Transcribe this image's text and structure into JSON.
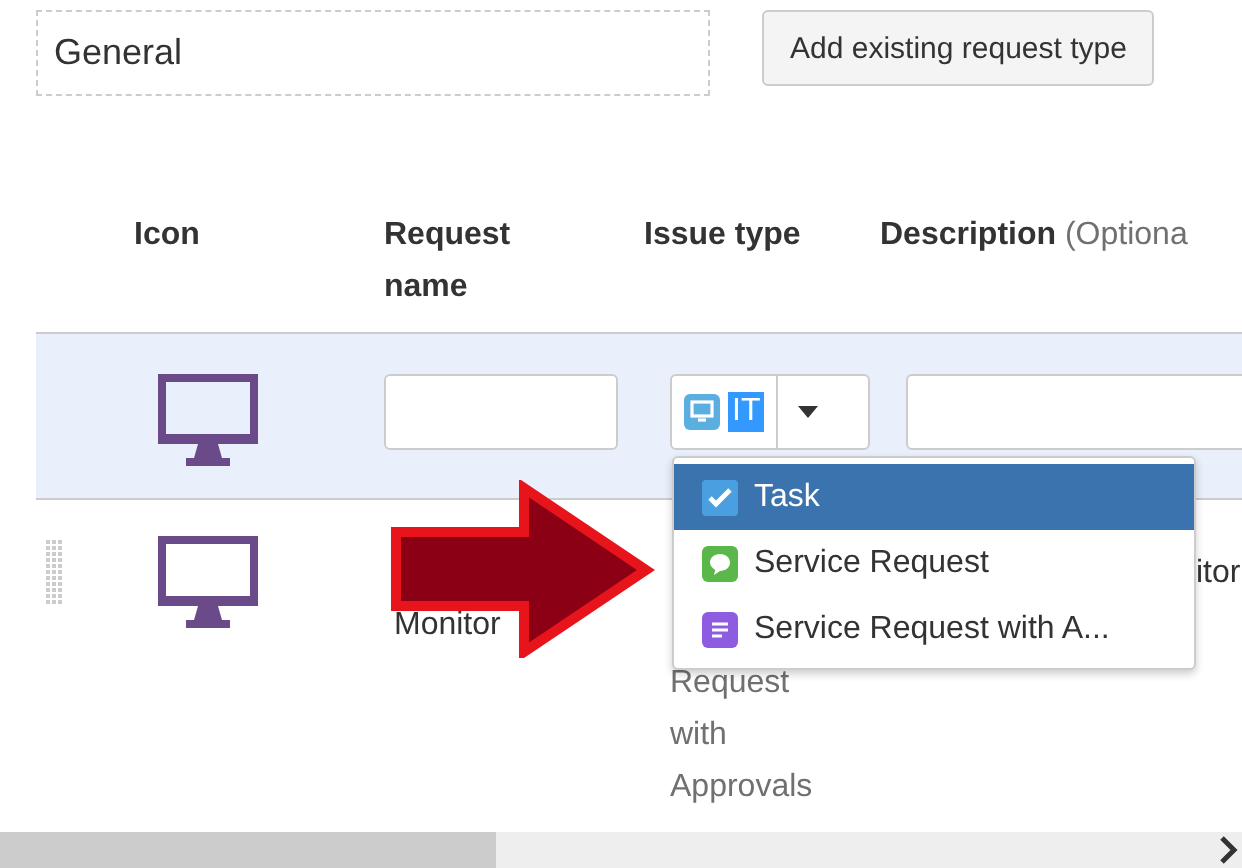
{
  "name_field": {
    "value": "General"
  },
  "add_button": {
    "label": "Add existing request type"
  },
  "table": {
    "columns": [
      {
        "label": "Icon"
      },
      {
        "label": "Request name"
      },
      {
        "label": "Issue type"
      },
      {
        "label": "Description",
        "note": "(Optiona"
      }
    ],
    "edit_row": {
      "issue_type": {
        "text": "IT"
      }
    },
    "rows": [
      {
        "request_name": "Monitor",
        "issue_type": "Request with Approvals",
        "description": "itor"
      }
    ]
  },
  "dropdown": {
    "items": [
      {
        "label": "Task",
        "kind": "task",
        "selected": true
      },
      {
        "label": "Service Request",
        "kind": "service",
        "selected": false
      },
      {
        "label": "Service Request with A...",
        "kind": "approval",
        "selected": false
      }
    ]
  }
}
